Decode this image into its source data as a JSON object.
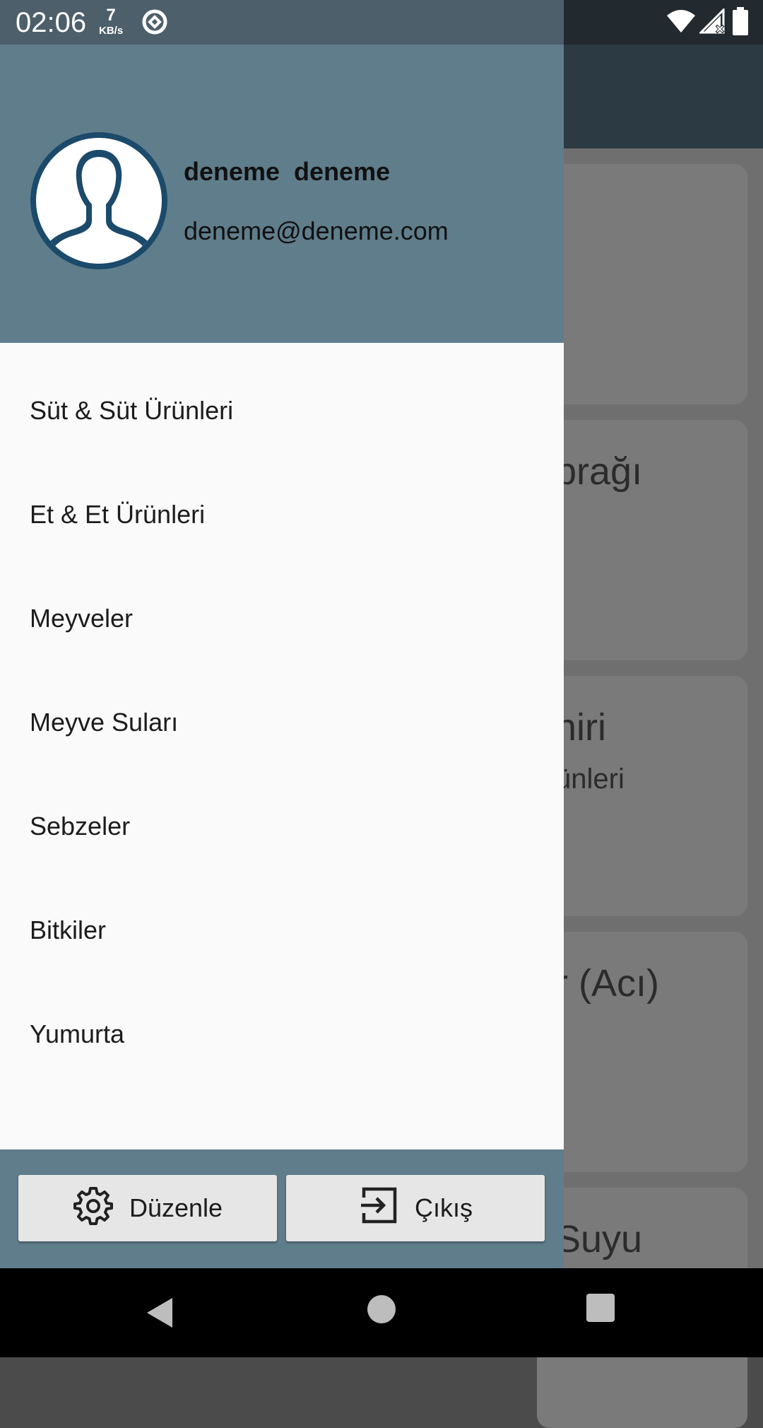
{
  "status_bar": {
    "time": "02:06",
    "net_speed_value": "7",
    "net_speed_unit": "KB/s",
    "icons": [
      "data-saver-icon",
      "wifi-icon",
      "signal-no-data-icon",
      "battery-icon"
    ]
  },
  "background": {
    "cards": [
      {
        "title": "prağı",
        "subtitle": ""
      },
      {
        "title": "niri",
        "subtitle": "ünleri"
      },
      {
        "title": "r (Acı)",
        "subtitle": ""
      },
      {
        "title": "Suyu",
        "subtitle": ""
      }
    ]
  },
  "drawer": {
    "user_name": "deneme  deneme",
    "user_email": "deneme@deneme.com",
    "menu": [
      {
        "label": "Süt & Süt Ürünleri"
      },
      {
        "label": "Et & Et Ürünleri"
      },
      {
        "label": "Meyveler"
      },
      {
        "label": "Meyve Suları"
      },
      {
        "label": "Sebzeler"
      },
      {
        "label": "Bitkiler"
      },
      {
        "label": "Yumurta"
      }
    ],
    "footer": {
      "edit_label": "Düzenle",
      "logout_label": "Çıkış"
    }
  },
  "colors": {
    "drawer_header": "#607d8b",
    "app_bar": "#2c3a44",
    "drawer_body": "#fafafa"
  }
}
